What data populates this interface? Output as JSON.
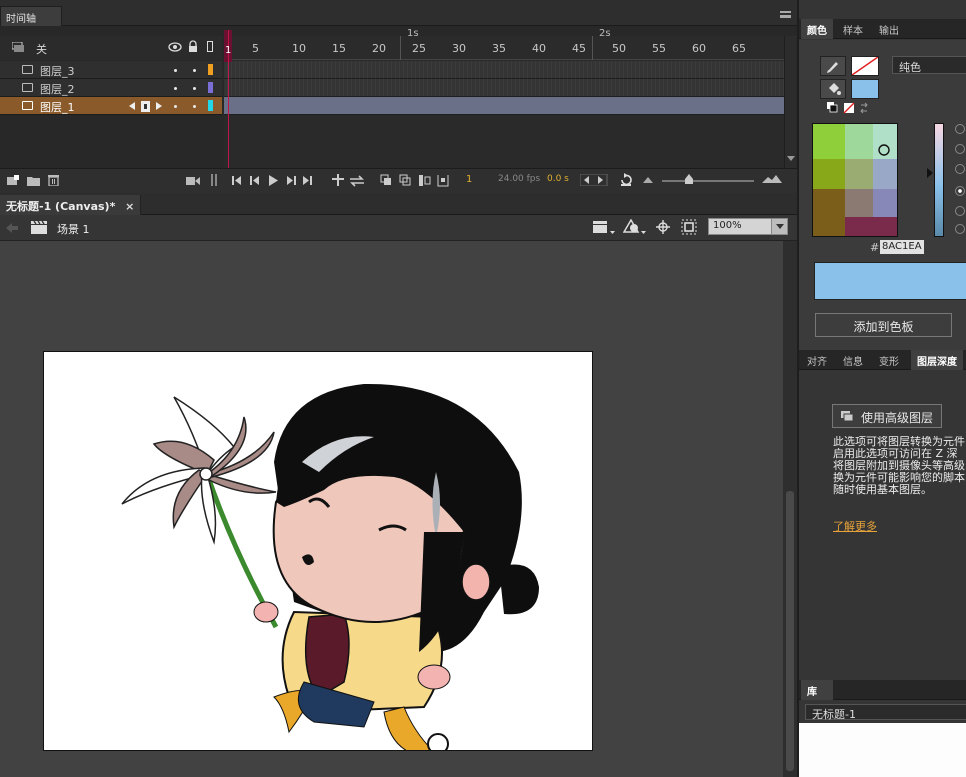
{
  "timeline": {
    "tab_label": "时间轴",
    "header_label": "关",
    "ruler_numbers": [
      "1",
      "5",
      "10",
      "15",
      "20",
      "25",
      "30",
      "35",
      "40",
      "45",
      "50",
      "55",
      "60",
      "65"
    ],
    "second_markers": [
      "1s",
      "2s"
    ],
    "layers": [
      {
        "name": "图层_3",
        "color": "#f0a020",
        "active": false
      },
      {
        "name": "图层_2",
        "color": "#7b6fd6",
        "active": false
      },
      {
        "name": "图层_1",
        "color": "#22d8e8",
        "active": true
      }
    ],
    "current_frame": "1",
    "fps": "24.00 fps",
    "time": "0.0 s"
  },
  "document": {
    "tab_label": "无标题-1 (Canvas)*",
    "close_glyph": "×",
    "scene_label": "场景 1",
    "zoom": "100%"
  },
  "color_panel": {
    "tabs": [
      "颜色",
      "样本",
      "输出"
    ],
    "active_tab": "颜色",
    "fill_type": "纯色",
    "hex_prefix": "#",
    "hex_value": "8AC1EA",
    "current_color": "#8AC1EA",
    "add_swatch_button": "添加到色板"
  },
  "properties_panel": {
    "tabs": [
      "对齐",
      "信息",
      "变形",
      "图层深度"
    ],
    "active_tab": "图层深度",
    "advanced_layers_button": "使用高级图层",
    "description_lines": [
      "此选项可将图层转换为元件",
      "启用此选项可访问在 Z 深",
      "将图层附加到摄像头等高级",
      "换为元件可能影响您的脚本",
      "随时使用基本图层。"
    ],
    "learn_more": "了解更多"
  },
  "library_panel": {
    "tab_label": "库",
    "document_select": "无标题-1"
  }
}
